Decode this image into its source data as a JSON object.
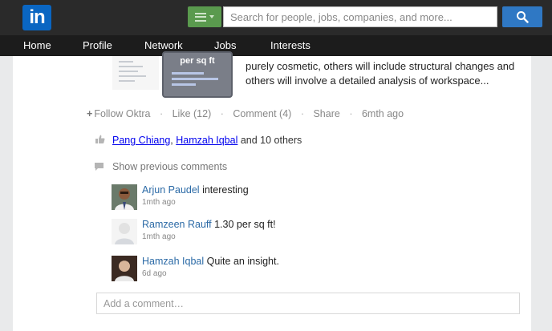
{
  "header": {
    "logo_text": "in",
    "search_placeholder": "Search for people, jobs, companies, and more...",
    "colors": {
      "brand": "#0a66c2",
      "search_button": "#2f78c4",
      "menu_button": "#5a9a4e"
    }
  },
  "nav": {
    "items": [
      {
        "label": "Home"
      },
      {
        "label": "Profile"
      },
      {
        "label": "Network"
      },
      {
        "label": "Jobs"
      },
      {
        "label": "Interests"
      }
    ]
  },
  "post": {
    "thumbnail_title": "per sq ft",
    "snippet_line1": "purely cosmetic, others will include structural changes and",
    "snippet_line2": "others will involve a detailed analysis of workspace...",
    "actions": {
      "follow": "Follow Oktra",
      "like": "Like (12)",
      "comment": "Comment (4)",
      "share": "Share",
      "time": "6mth ago"
    },
    "likes": {
      "person1": "Pang Chiang",
      "person2": "Hamzah Iqbal",
      "rest": "and 10 others"
    },
    "show_previous": "Show previous comments",
    "comments": [
      {
        "author": "Arjun Paudel",
        "text": "interesting",
        "time": "1mth ago"
      },
      {
        "author": "Ramzeen Rauff",
        "text": "1.30 per sq ft!",
        "time": "1mth ago"
      },
      {
        "author": "Hamzah Iqbal",
        "text": "Quite an insight.",
        "time": "6d ago"
      }
    ],
    "add_comment_placeholder": "Add a comment…"
  }
}
